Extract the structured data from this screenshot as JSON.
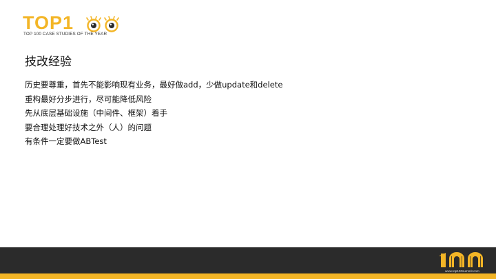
{
  "header": {
    "logo_text": "TOP1",
    "logo_tagline": "TOP 100 CASE STUDIES OF THE YEAR"
  },
  "slide": {
    "title": "技改经验",
    "bullets": [
      "历史要尊重，首先不能影响现有业务，最好做add，少做update和delete",
      "重构最好分步进行，尽可能降低风险",
      "先从底层基础设施（中间件、框架）着手",
      "要合理处理好技术之外（人）的问题",
      "有条件一定要做ABTest"
    ]
  },
  "footer": {
    "logo_text": "100",
    "url": "www.top100summit.com"
  },
  "colors": {
    "brand_yellow": "#f3b526",
    "footer_dark": "#2b2b2b",
    "text": "#111111"
  },
  "icons": [
    "top100-eyes-logo-icon",
    "top100-footer-logo-icon"
  ]
}
